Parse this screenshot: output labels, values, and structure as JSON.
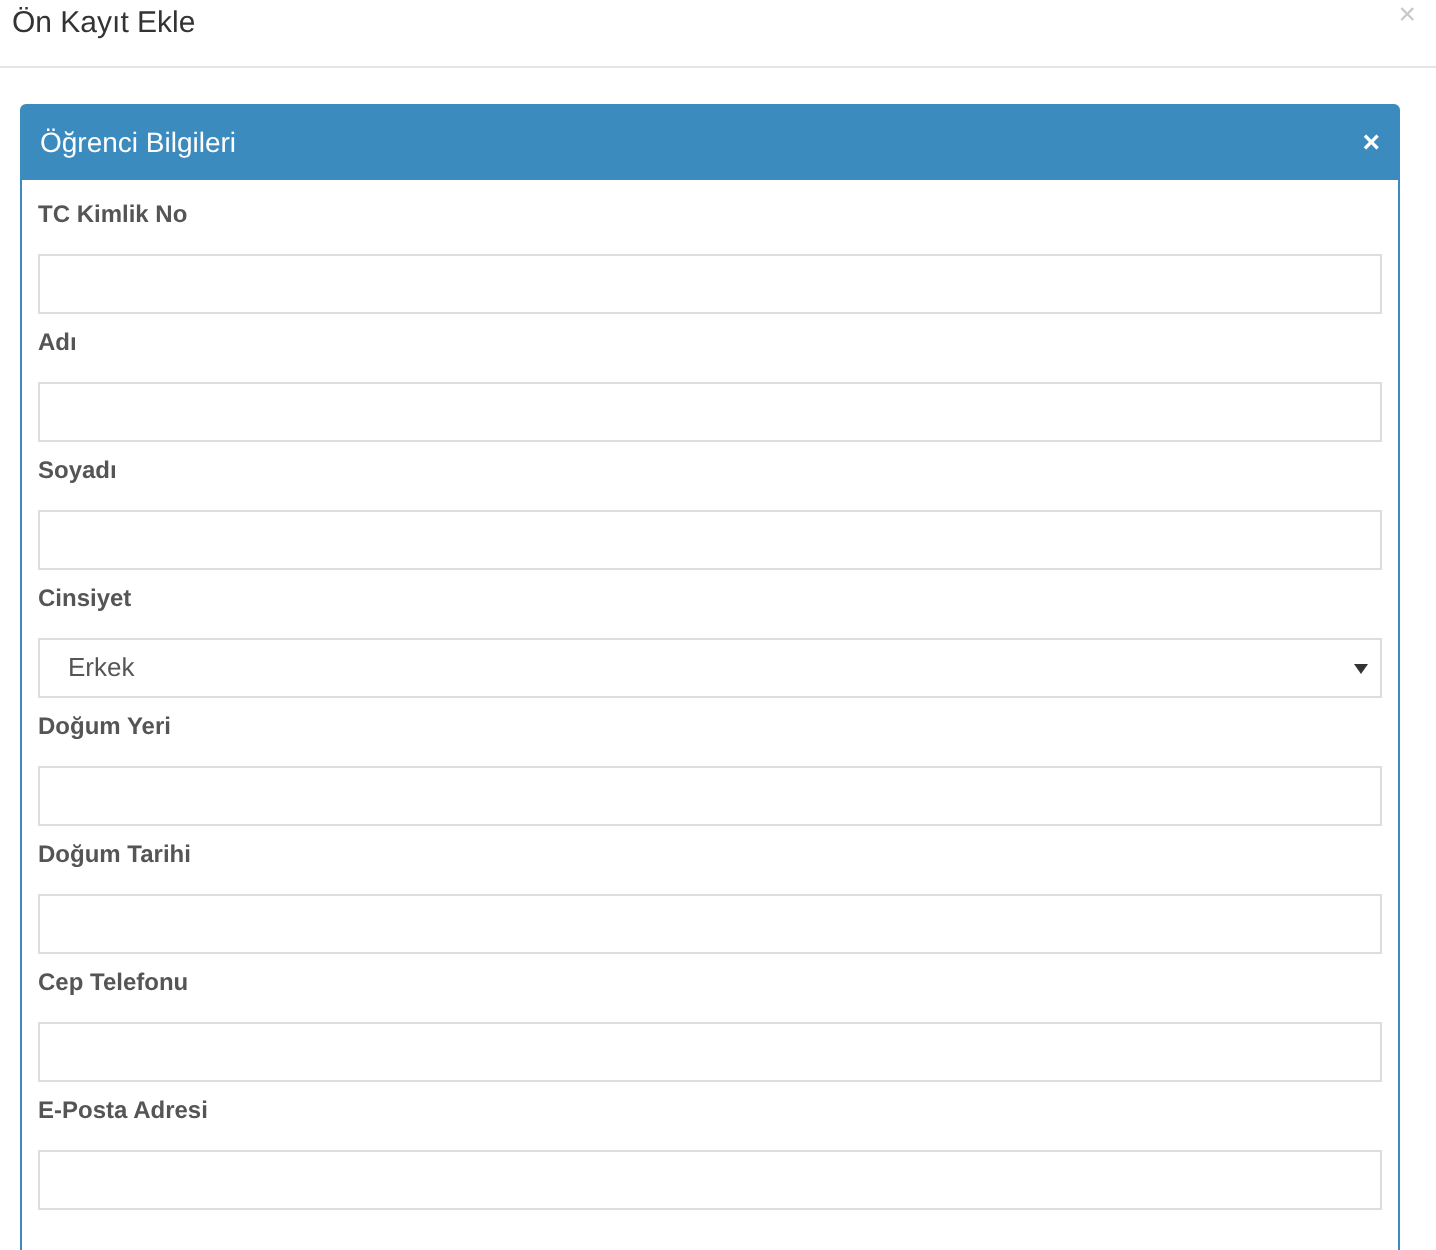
{
  "dialog": {
    "title": "Ön Kayıt Ekle",
    "close": "×"
  },
  "panel": {
    "title": "Öğrenci Bilgileri",
    "close": "×",
    "fields": [
      {
        "kind": "text",
        "label": "TC Kimlik No"
      },
      {
        "kind": "text",
        "label": "Adı"
      },
      {
        "kind": "text",
        "label": "Soyadı"
      },
      {
        "kind": "select",
        "label": "Cinsiyet",
        "value": "Erkek"
      },
      {
        "kind": "text",
        "label": "Doğum Yeri"
      },
      {
        "kind": "text",
        "label": "Doğum Tarihi"
      },
      {
        "kind": "text",
        "label": "Cep Telefonu"
      },
      {
        "kind": "text",
        "label": "E-Posta Adresi"
      }
    ]
  }
}
